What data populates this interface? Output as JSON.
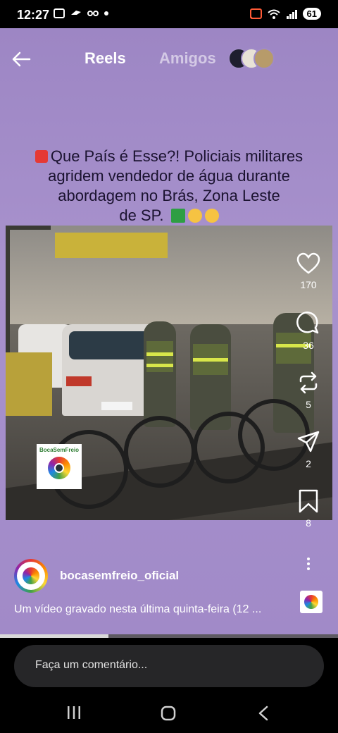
{
  "status_bar": {
    "time": "12:27",
    "battery": "61"
  },
  "nav": {
    "reels_tab": "Reels",
    "friends_tab": "Amigos"
  },
  "post": {
    "headline_lines": [
      "Que País é Esse?! Policiais militares",
      "agridem vendedor de água durante",
      "abordagem no Brás, Zona Leste",
      "de SP."
    ],
    "watermark_text": "BocaSemFreio",
    "author": "bocasemfreio_oficial",
    "caption": "Um vídeo gravado nesta  última quinta-feira (12 ..."
  },
  "actions": [
    {
      "name": "like",
      "icon": "heart-icon",
      "count": "170"
    },
    {
      "name": "comment",
      "icon": "comment-icon",
      "count": "36"
    },
    {
      "name": "repost",
      "icon": "repost-icon",
      "count": "5"
    },
    {
      "name": "share",
      "icon": "send-icon",
      "count": "2"
    },
    {
      "name": "save",
      "icon": "bookmark-icon",
      "count": "8"
    }
  ],
  "video_progress": 0.32,
  "comment_input": {
    "placeholder": "Faça um comentário..."
  },
  "colors": {
    "reel_background": "#a08bc6",
    "headline_text": "#1b1330",
    "accent_siren": "#e53935"
  }
}
